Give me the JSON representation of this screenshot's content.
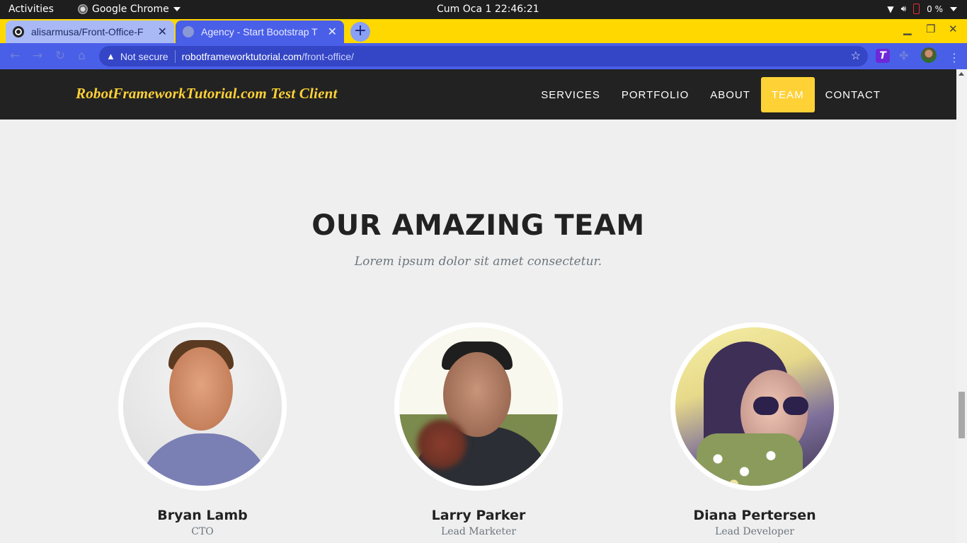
{
  "system_bar": {
    "activities": "Activities",
    "app_name": "Google Chrome",
    "clock": "Cum Oca 1  22:46:21",
    "battery": "0 %"
  },
  "browser": {
    "tabs": [
      {
        "title": "alisarmusa/Front-Office-F",
        "favicon": "github-icon",
        "active": false
      },
      {
        "title": "Agency - Start Bootstrap T",
        "favicon": "globe-icon",
        "active": true
      }
    ],
    "new_tab": "+",
    "security_label": "Not secure",
    "url_host": "robotframeworktutorial.com",
    "url_path": "/front-office/",
    "accent_color": "#4a5fe8",
    "tabstrip_color": "#ffd800"
  },
  "site": {
    "brand": "RobotFrameworkTutorial.com Test Client",
    "nav": [
      {
        "label": "SERVICES",
        "active": false
      },
      {
        "label": "PORTFOLIO",
        "active": false
      },
      {
        "label": "ABOUT",
        "active": false
      },
      {
        "label": "TEAM",
        "active": true
      },
      {
        "label": "CONTACT",
        "active": false
      }
    ],
    "brand_color": "#fed136"
  },
  "team": {
    "heading": "OUR AMAZING TEAM",
    "subheading": "Lorem ipsum dolor sit amet consectetur.",
    "members": [
      {
        "name": "Bryan Lamb",
        "role": "CTO"
      },
      {
        "name": "Larry Parker",
        "role": "Lead Marketer"
      },
      {
        "name": "Diana Pertersen",
        "role": "Lead Developer"
      }
    ]
  }
}
